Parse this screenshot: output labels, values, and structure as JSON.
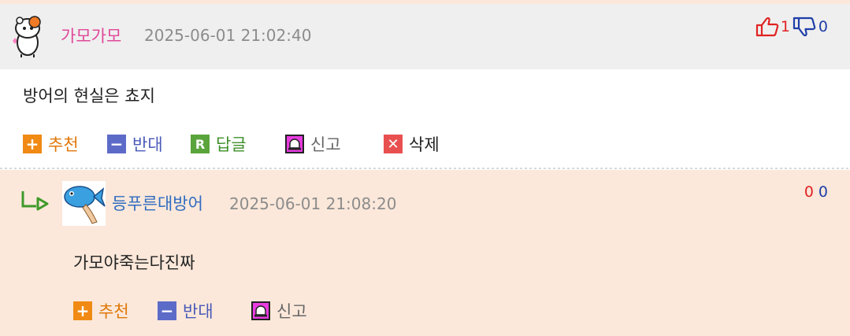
{
  "comment": {
    "nickname": "가모가모",
    "timestamp": "2025-06-01 21:02:40",
    "likes": "1",
    "dislikes": "0",
    "content": "방어의 현실은 쵸지",
    "actions": {
      "recommend": "추천",
      "oppose": "반대",
      "reply": "답글",
      "report": "신고",
      "delete": "삭제"
    }
  },
  "reply": {
    "nickname": "등푸른대방어",
    "timestamp": "2025-06-01 21:08:20",
    "likes": "0",
    "dislikes": "0",
    "content": "가모야죽는다진짜",
    "actions": {
      "recommend": "추천",
      "oppose": "반대",
      "report": "신고"
    }
  },
  "icons": {
    "reply_icon": "R",
    "colors": {
      "recommend": "#f08a14",
      "oppose": "#5d6bc8",
      "reply": "#5aa43c",
      "report": "#e83be0",
      "delete": "#e85050"
    }
  }
}
